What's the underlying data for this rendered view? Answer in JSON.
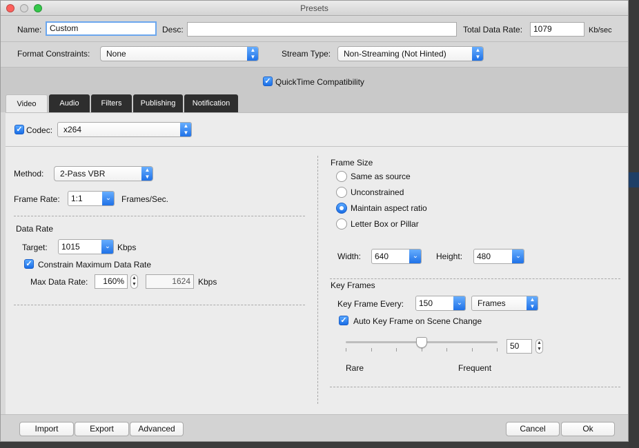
{
  "window": {
    "title": "Presets"
  },
  "header": {
    "name_label": "Name:",
    "name_value": "Custom",
    "desc_label": "Desc:",
    "desc_value": "",
    "total_rate_label": "Total Data Rate:",
    "total_rate_value": "1079",
    "total_rate_unit": "Kb/sec",
    "format_label": "Format Constraints:",
    "format_value": "None",
    "stream_label": "Stream Type:",
    "stream_value": "Non-Streaming (Not Hinted)",
    "qt_compat_label": "QuickTime Compatibility",
    "qt_compat_checked": true
  },
  "tabs": [
    {
      "label": "Video"
    },
    {
      "label": "Audio"
    },
    {
      "label": "Filters"
    },
    {
      "label": "Publishing"
    },
    {
      "label": "Notification"
    }
  ],
  "active_tab": "Video",
  "codec": {
    "label": "Codec:",
    "value": "x264",
    "checked": true
  },
  "left": {
    "method_label": "Method:",
    "method_value": "2-Pass VBR",
    "frame_rate_label": "Frame Rate:",
    "frame_rate_value": "1:1",
    "frame_rate_unit": "Frames/Sec.",
    "data_rate_title": "Data Rate",
    "target_label": "Target:",
    "target_value": "1015",
    "target_unit": "Kbps",
    "constrain_label": "Constrain Maximum Data Rate",
    "constrain_checked": true,
    "max_label": "Max Data Rate:",
    "max_percent": "160%",
    "max_value": "1624",
    "max_unit": "Kbps"
  },
  "right": {
    "frame_size_title": "Frame Size",
    "radios": [
      {
        "label": "Same as source",
        "selected": false
      },
      {
        "label": "Unconstrained",
        "selected": false
      },
      {
        "label": "Maintain aspect ratio",
        "selected": true
      },
      {
        "label": "Letter Box or Pillar",
        "selected": false
      }
    ],
    "width_label": "Width:",
    "width_value": "640",
    "height_label": "Height:",
    "height_value": "480",
    "key_frames_title": "Key Frames",
    "kf_every_label": "Key Frame Every:",
    "kf_every_value": "150",
    "kf_unit_value": "Frames",
    "auto_kf_label": "Auto Key Frame on Scene Change",
    "auto_kf_checked": true,
    "slider_value": "50",
    "slider_fraction": 0.5,
    "rare_label": "Rare",
    "frequent_label": "Frequent"
  },
  "footer": {
    "import": "Import",
    "export": "Export",
    "advanced": "Advanced",
    "cancel": "Cancel",
    "ok": "Ok"
  }
}
